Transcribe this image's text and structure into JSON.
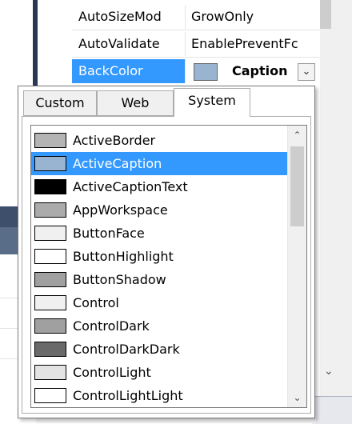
{
  "property_grid": {
    "rows": [
      {
        "name": "AutoSizeMod",
        "value": "GrowOnly"
      },
      {
        "name": "AutoValidate",
        "value": "EnablePreventFc"
      },
      {
        "name": "BackColor",
        "value": "Caption"
      }
    ],
    "backcolor_swatch_color": "#99b4d1"
  },
  "color_picker": {
    "tabs": [
      {
        "label": "Custom",
        "active": false
      },
      {
        "label": "Web",
        "active": false
      },
      {
        "label": "System",
        "active": true
      }
    ],
    "selected": "ActiveCaption",
    "items": [
      {
        "label": "ActiveBorder",
        "color": "#b4b4b4"
      },
      {
        "label": "ActiveCaption",
        "color": "#99b4d1"
      },
      {
        "label": "ActiveCaptionText",
        "color": "#000000"
      },
      {
        "label": "AppWorkspace",
        "color": "#ababab"
      },
      {
        "label": "ButtonFace",
        "color": "#f0f0f0"
      },
      {
        "label": "ButtonHighlight",
        "color": "#ffffff"
      },
      {
        "label": "ButtonShadow",
        "color": "#a0a0a0"
      },
      {
        "label": "Control",
        "color": "#f0f0f0"
      },
      {
        "label": "ControlDark",
        "color": "#a0a0a0"
      },
      {
        "label": "ControlDarkDark",
        "color": "#696969"
      },
      {
        "label": "ControlLight",
        "color": "#e3e3e3"
      },
      {
        "label": "ControlLightLight",
        "color": "#ffffff"
      }
    ]
  },
  "colors": {
    "selection": "#3399ff",
    "ide_dark": "#293955"
  }
}
